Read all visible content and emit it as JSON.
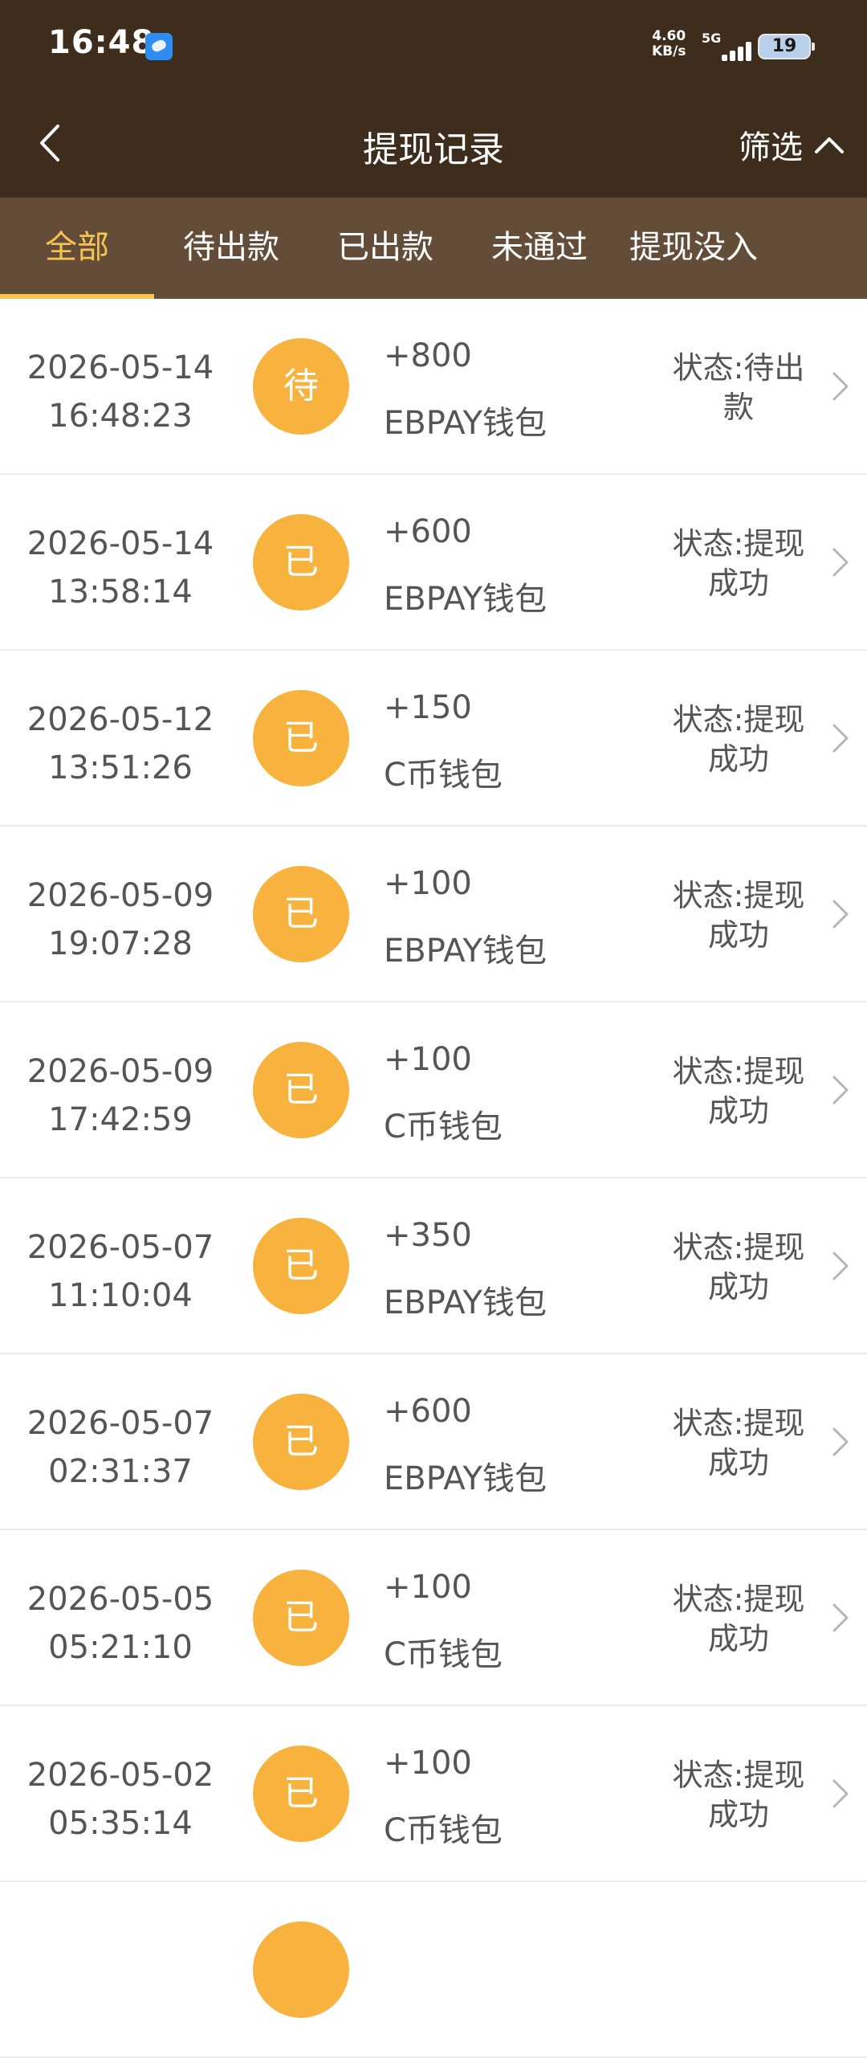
{
  "statusbar": {
    "time": "16:48",
    "net_speed": "4.60",
    "net_speed_unit": "KB/s",
    "network": "5G",
    "battery": "19"
  },
  "header": {
    "title": "提现记录",
    "filter_label": "筛选"
  },
  "tabs": [
    {
      "label": "全部",
      "active": true
    },
    {
      "label": "待出款",
      "active": false
    },
    {
      "label": "已出款",
      "active": false
    },
    {
      "label": "未通过",
      "active": false
    },
    {
      "label": "提现没入",
      "active": false
    }
  ],
  "records": [
    {
      "date": "2026-05-14",
      "time": "16:48:23",
      "badge": "待",
      "amount": "+800",
      "wallet": "EBPAY钱包",
      "status_l1": "状态:待出",
      "status_l2": "款"
    },
    {
      "date": "2026-05-14",
      "time": "13:58:14",
      "badge": "已",
      "amount": "+600",
      "wallet": "EBPAY钱包",
      "status_l1": "状态:提现",
      "status_l2": "成功"
    },
    {
      "date": "2026-05-12",
      "time": "13:51:26",
      "badge": "已",
      "amount": "+150",
      "wallet": "C币钱包",
      "status_l1": "状态:提现",
      "status_l2": "成功"
    },
    {
      "date": "2026-05-09",
      "time": "19:07:28",
      "badge": "已",
      "amount": "+100",
      "wallet": "EBPAY钱包",
      "status_l1": "状态:提现",
      "status_l2": "成功"
    },
    {
      "date": "2026-05-09",
      "time": "17:42:59",
      "badge": "已",
      "amount": "+100",
      "wallet": "C币钱包",
      "status_l1": "状态:提现",
      "status_l2": "成功"
    },
    {
      "date": "2026-05-07",
      "time": "11:10:04",
      "badge": "已",
      "amount": "+350",
      "wallet": "EBPAY钱包",
      "status_l1": "状态:提现",
      "status_l2": "成功"
    },
    {
      "date": "2026-05-07",
      "time": "02:31:37",
      "badge": "已",
      "amount": "+600",
      "wallet": "EBPAY钱包",
      "status_l1": "状态:提现",
      "status_l2": "成功"
    },
    {
      "date": "2026-05-05",
      "time": "05:21:10",
      "badge": "已",
      "amount": "+100",
      "wallet": "C币钱包",
      "status_l1": "状态:提现",
      "status_l2": "成功"
    },
    {
      "date": "2026-05-02",
      "time": "05:35:14",
      "badge": "已",
      "amount": "+100",
      "wallet": "C币钱包",
      "status_l1": "状态:提现",
      "status_l2": "成功"
    }
  ],
  "colors": {
    "header_bg": "#3e2d1d",
    "tabs_bg": "#634d38",
    "accent": "#f7c352",
    "badge": "#f8b33f"
  }
}
